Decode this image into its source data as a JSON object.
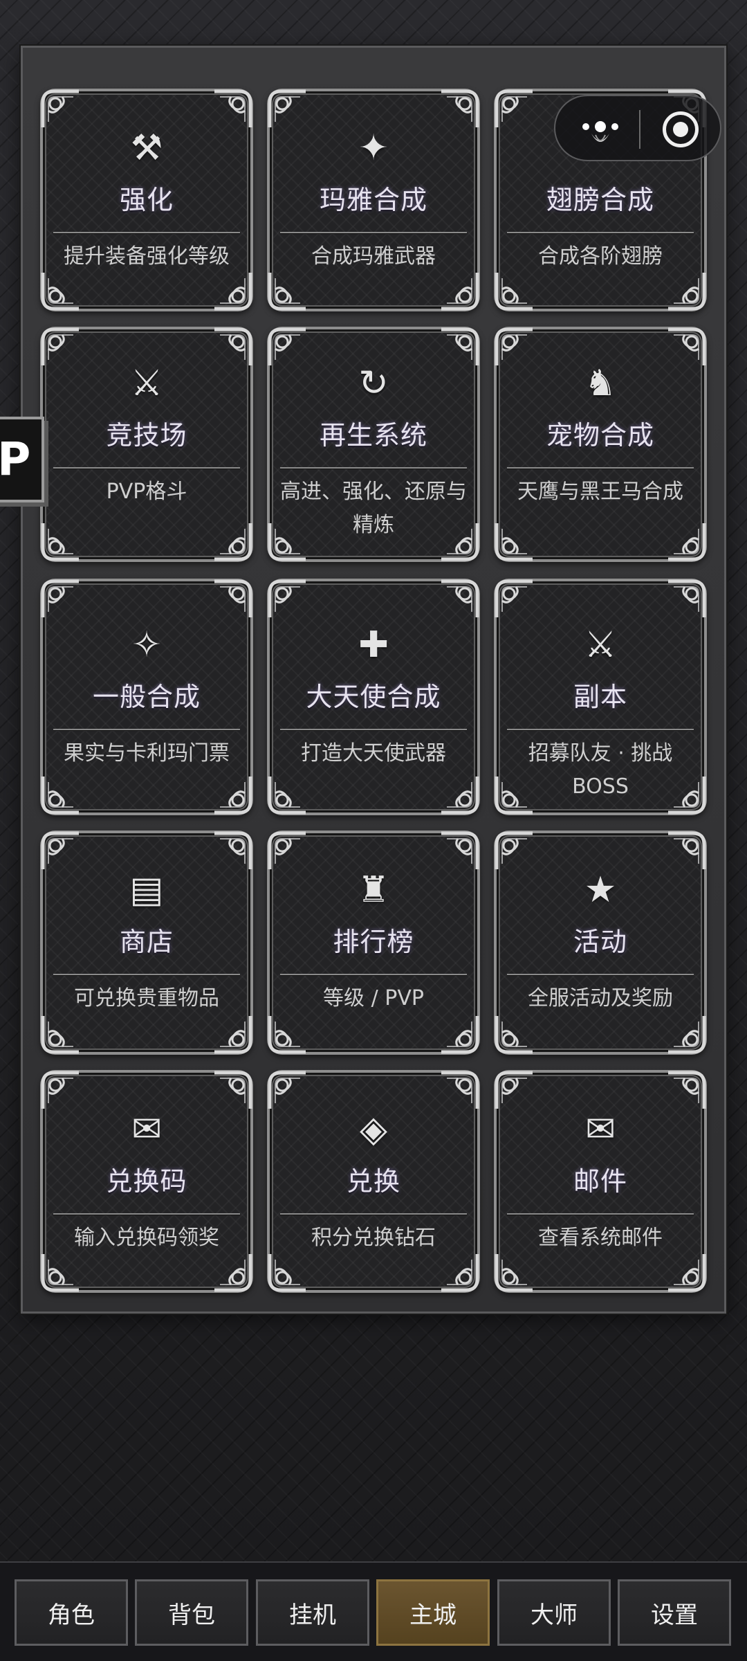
{
  "cards": [
    {
      "icon": "⚒",
      "icon_name": "hammers-icon",
      "title": "强化",
      "desc": "提升装备强化等级"
    },
    {
      "icon": "✦",
      "icon_name": "four-point-star-icon",
      "title": "玛雅合成",
      "desc": "合成玛雅武器"
    },
    {
      "icon": "",
      "icon_name": "",
      "title": "翅膀合成",
      "desc": "合成各阶翅膀"
    },
    {
      "icon": "⚔",
      "icon_name": "crossed-swords-icon",
      "title": "竞技场",
      "desc": "PVP格斗"
    },
    {
      "icon": "↻",
      "icon_name": "refresh-icon",
      "title": "再生系统",
      "desc": "高进、强化、还原与精炼"
    },
    {
      "icon": "♞",
      "icon_name": "horse-icon",
      "title": "宠物合成",
      "desc": "天鹰与黑王马合成"
    },
    {
      "icon": "✧",
      "icon_name": "sparkle-outline-icon",
      "title": "一般合成",
      "desc": "果实与卡利玛门票"
    },
    {
      "icon": "✚",
      "icon_name": "plus-cross-icon",
      "title": "大天使合成",
      "desc": "打造大天使武器"
    },
    {
      "icon": "⚔",
      "icon_name": "crossed-swords-icon",
      "title": "副本",
      "desc": "招募队友 · 挑战 BOSS"
    },
    {
      "icon": "▤",
      "icon_name": "shop-list-icon",
      "title": "商店",
      "desc": "可兑换贵重物品"
    },
    {
      "icon": "♜",
      "icon_name": "rook-tower-icon",
      "title": "排行榜",
      "desc": "等级 / PVP"
    },
    {
      "icon": "★",
      "icon_name": "star-icon",
      "title": "活动",
      "desc": "全服活动及奖励"
    },
    {
      "icon": "✉",
      "icon_name": "envelope-icon",
      "title": "兑换码",
      "desc": "输入兑换码领奖"
    },
    {
      "icon": "◈",
      "icon_name": "diamond-icon",
      "title": "兑换",
      "desc": "积分兑换钻石"
    },
    {
      "icon": "✉",
      "icon_name": "envelope-icon",
      "title": "邮件",
      "desc": "查看系统邮件"
    }
  ],
  "side_tab": {
    "label": "P"
  },
  "capsule": {
    "more_icon": "more-dots-icon",
    "close_icon": "close-target-icon"
  },
  "nav": {
    "items": [
      {
        "label": "角色",
        "active": false
      },
      {
        "label": "背包",
        "active": false
      },
      {
        "label": "挂机",
        "active": false
      },
      {
        "label": "主城",
        "active": true
      },
      {
        "label": "大师",
        "active": false
      },
      {
        "label": "设置",
        "active": false
      }
    ]
  },
  "colors": {
    "nav_active": "#5e4a26",
    "title_glow": "#aa96e6",
    "panel": "#333335"
  }
}
